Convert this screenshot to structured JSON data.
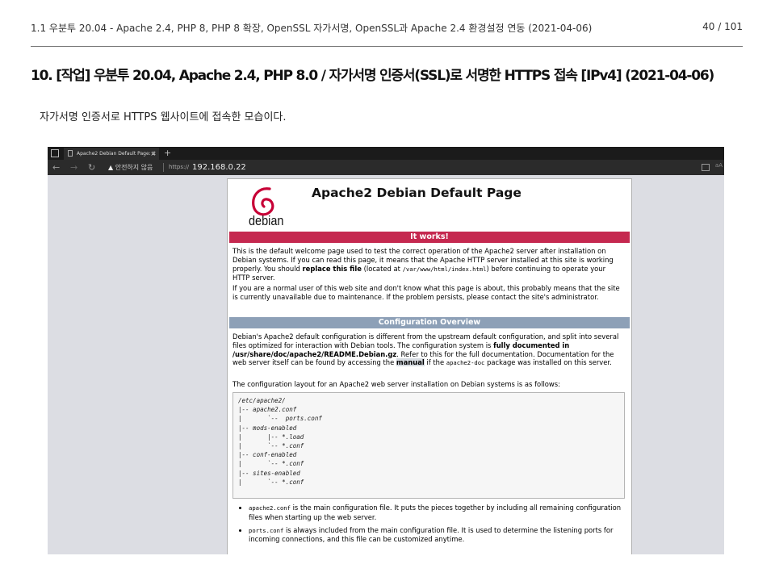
{
  "doc_header": {
    "title": "1.1 우분투 20.04 - Apache 2.4, PHP 8, PHP 8 확장, OpenSSL 자가서명, OpenSSL과 Apache 2.4 환경설정 연동 (2021-04-06)",
    "page": "40 / 101"
  },
  "section_title": "10. [작업] 우분투 20.04, Apache 2.4, PHP 8.0 / 자가서명 인증서(SSL)로 서명한 HTTPS 접속 [IPv4] (2021-04-06)",
  "paragraph": "자가서명 인증서로 HTTPS 웹사이트에 접속한 모습이다.",
  "browser": {
    "tab_title": "Apache2 Debian Default Page: It",
    "new_tab": "+",
    "security_warning": "안전하지 않음",
    "protocol": "https://",
    "host": "192.168.0.22",
    "right_text": "aA"
  },
  "apache_page": {
    "logo_text": "debian",
    "title": "Apache2 Debian Default Page",
    "it_works": "It works!",
    "welcome_1": "This is the default welcome page used to test the correct operation of the Apache2 server after installation on Debian systems. If you can read this page, it means that the Apache HTTP server installed at this site is working properly. You should",
    "welcome_bold": "replace this file",
    "welcome_2": "(located at",
    "welcome_path": "/var/www/html/index.html",
    "welcome_3": ") before continuing to operate your HTTP server.",
    "normal_user": "If you are a normal user of this web site and don't know what this page is about, this probably means that the site is currently unavailable due to maintenance. If the problem persists, please contact the site's administrator.",
    "config_overview": "Configuration Overview",
    "config_1": "Debian's Apache2 default configuration is different from the upstream default configuration, and split into several files optimized for interaction with Debian tools. The configuration system is",
    "config_bold": "fully documented in /usr/share/doc/apache2/README.Debian.gz",
    "config_2": ". Refer to this for the full documentation. Documentation for the web server itself can be found by accessing the",
    "config_manual": "manual",
    "config_3": "if the",
    "config_doc": "apache2-doc",
    "config_4": "package was installed on this server.",
    "layout_intro": "The configuration layout for an Apache2 web server installation on Debian systems is as follows:",
    "tree": "/etc/apache2/\n|-- apache2.conf\n|       `--  ports.conf\n|-- mods-enabled\n|       |-- *.load\n|       `-- *.conf\n|-- conf-enabled\n|       `-- *.conf\n|-- sites-enabled\n|       `-- *.conf",
    "bullets": [
      {
        "code": "apache2.conf",
        "text": "is the main configuration file. It puts the pieces together by including all remaining configuration files when starting up the web server."
      },
      {
        "code": "ports.conf",
        "text": "is always included from the main configuration file. It is used to determine the listening ports for incoming connections, and this file can be customized anytime."
      }
    ]
  }
}
